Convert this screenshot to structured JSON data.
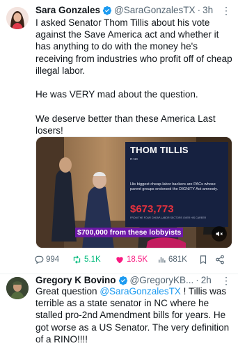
{
  "tweets": [
    {
      "author": "Sara Gonzales",
      "handle": "@SaraGonzalesTX",
      "time": "3h",
      "text": "I asked Senator Thom Tillis about his vote against the Save America act and whether it has anything to do with the money he's receiving from industries who profit off of cheap illegal labor.\n\nHe was VERY mad about the question.\n\nWe deserve better than these America Last losers!",
      "media": {
        "caption": "$700,000 from these lobbyists",
        "card": {
          "title": "THOM TILLIS",
          "subtitle": "R-NC",
          "body": "His biggest cheap-labor backers are PACs whose parent groups endorsed the DIGNITY Act amnesty.",
          "amount": "$673,773",
          "footnote": "FROM THE FOUR CHEAP-LABOR SECTORS OVER HIS CAREER"
        }
      },
      "stats": {
        "replies": "994",
        "retweets": "5.1K",
        "likes": "18.5K",
        "views": "681K"
      }
    },
    {
      "author": "Gregory K Bovino",
      "handle": "@GregoryKB...",
      "time": "2h",
      "text_before": "Great question ",
      "mention": "@SaraGonzalesTX",
      "text_after": " !  Tillis was terrible as a state senator in NC where he stalled pro-2nd Amendment bills for years.  He got worse as a US Senator.  The very definition of a RINO!!!!"
    }
  ],
  "separator": "·",
  "more_glyph": "⋮",
  "colors": {
    "verified": "#1d9bf0",
    "retweet": "#00ba7c",
    "like": "#f91880",
    "muted": "#536471",
    "caption_bg": "#6d18a7"
  },
  "icons": [
    "verified-badge-icon",
    "more-icon",
    "reply-icon",
    "retweet-icon",
    "heart-icon",
    "views-icon",
    "bookmark-icon",
    "share-icon",
    "volume-muted-icon"
  ]
}
